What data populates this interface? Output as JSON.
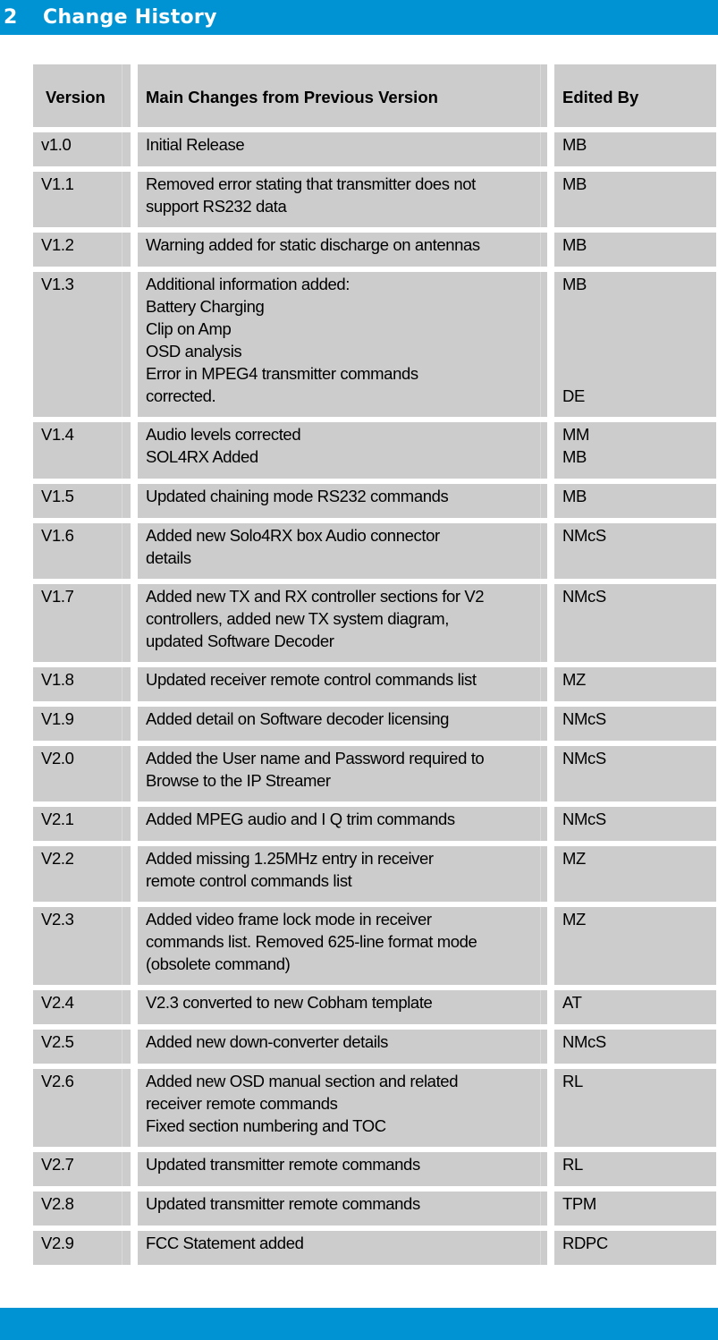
{
  "section": {
    "number": "2",
    "title": "Change History"
  },
  "table": {
    "headers": {
      "version": "Version",
      "changes": "Main Changes from Previous Version",
      "edited_by": "Edited By"
    },
    "rows": [
      {
        "version": "v1.0",
        "changes": "Initial Release",
        "edited_by": "MB"
      },
      {
        "version": "V1.1",
        "changes": "Removed error stating that transmitter does not\nsupport RS232 data",
        "edited_by": "MB"
      },
      {
        "version": "V1.2",
        "changes": "Warning added for static discharge on antennas",
        "edited_by": "MB"
      },
      {
        "version": "V1.3",
        "changes": "Additional information added:\nBattery Charging\nClip on Amp\nOSD analysis\nError in MPEG4 transmitter commands\ncorrected.",
        "edited_by": "MB\n\n\n\n\nDE"
      },
      {
        "version": "V1.4",
        "changes": "Audio levels corrected\nSOL4RX Added",
        "edited_by": "MM\nMB"
      },
      {
        "version": "V1.5",
        "changes": "Updated chaining mode RS232 commands",
        "edited_by": "MB"
      },
      {
        "version": "V1.6",
        "changes": "Added new Solo4RX box Audio connector\ndetails",
        "edited_by": "NMcS"
      },
      {
        "version": "V1.7",
        "changes": "Added new TX and RX controller sections for V2\ncontrollers, added new TX system diagram,\nupdated Software Decoder",
        "edited_by": "NMcS"
      },
      {
        "version": "V1.8",
        "changes": "Updated receiver remote control commands list",
        "edited_by": "MZ"
      },
      {
        "version": "V1.9",
        "changes": "Added detail on Software decoder licensing",
        "edited_by": "NMcS"
      },
      {
        "version": "V2.0",
        "changes": "Added the User name and Password required to\nBrowse to the IP Streamer",
        "edited_by": "NMcS"
      },
      {
        "version": "V2.1",
        "changes": "Added MPEG audio and I Q trim commands",
        "edited_by": "NMcS"
      },
      {
        "version": "V2.2",
        "changes": "Added missing 1.25MHz entry in receiver\nremote control commands list",
        "edited_by": "MZ"
      },
      {
        "version": "V2.3",
        "changes": "Added video frame lock mode in receiver\ncommands list. Removed 625-line format mode\n(obsolete command)",
        "edited_by": "MZ"
      },
      {
        "version": "V2.4",
        "changes": "V2.3 converted to new Cobham template",
        "edited_by": "AT"
      },
      {
        "version": "V2.5",
        "changes": "Added new down-converter details",
        "edited_by": "NMcS"
      },
      {
        "version": "V2.6",
        "changes": "Added new OSD manual section and related\nreceiver remote commands\nFixed section numbering and TOC",
        "edited_by": "RL"
      },
      {
        "version": "V2.7",
        "changes": "Updated transmitter remote commands",
        "edited_by": "RL"
      },
      {
        "version": "V2.8",
        "changes": "Updated transmitter remote commands",
        "edited_by": "TPM"
      },
      {
        "version": "V2.9",
        "changes": "FCC Statement added",
        "edited_by": "RDPC"
      }
    ]
  },
  "colors": {
    "brand_blue": "#0093d3",
    "cell_gray": "#cccccc"
  }
}
